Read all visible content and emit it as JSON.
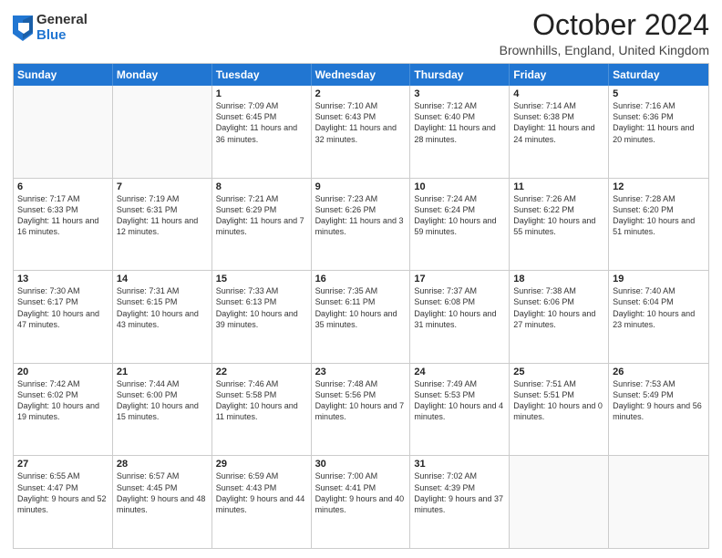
{
  "logo": {
    "general": "General",
    "blue": "Blue"
  },
  "header": {
    "month": "October 2024",
    "location": "Brownhills, England, United Kingdom"
  },
  "days": [
    "Sunday",
    "Monday",
    "Tuesday",
    "Wednesday",
    "Thursday",
    "Friday",
    "Saturday"
  ],
  "rows": [
    [
      {
        "day": "",
        "text": ""
      },
      {
        "day": "",
        "text": ""
      },
      {
        "day": "1",
        "text": "Sunrise: 7:09 AM\nSunset: 6:45 PM\nDaylight: 11 hours and 36 minutes."
      },
      {
        "day": "2",
        "text": "Sunrise: 7:10 AM\nSunset: 6:43 PM\nDaylight: 11 hours and 32 minutes."
      },
      {
        "day": "3",
        "text": "Sunrise: 7:12 AM\nSunset: 6:40 PM\nDaylight: 11 hours and 28 minutes."
      },
      {
        "day": "4",
        "text": "Sunrise: 7:14 AM\nSunset: 6:38 PM\nDaylight: 11 hours and 24 minutes."
      },
      {
        "day": "5",
        "text": "Sunrise: 7:16 AM\nSunset: 6:36 PM\nDaylight: 11 hours and 20 minutes."
      }
    ],
    [
      {
        "day": "6",
        "text": "Sunrise: 7:17 AM\nSunset: 6:33 PM\nDaylight: 11 hours and 16 minutes."
      },
      {
        "day": "7",
        "text": "Sunrise: 7:19 AM\nSunset: 6:31 PM\nDaylight: 11 hours and 12 minutes."
      },
      {
        "day": "8",
        "text": "Sunrise: 7:21 AM\nSunset: 6:29 PM\nDaylight: 11 hours and 7 minutes."
      },
      {
        "day": "9",
        "text": "Sunrise: 7:23 AM\nSunset: 6:26 PM\nDaylight: 11 hours and 3 minutes."
      },
      {
        "day": "10",
        "text": "Sunrise: 7:24 AM\nSunset: 6:24 PM\nDaylight: 10 hours and 59 minutes."
      },
      {
        "day": "11",
        "text": "Sunrise: 7:26 AM\nSunset: 6:22 PM\nDaylight: 10 hours and 55 minutes."
      },
      {
        "day": "12",
        "text": "Sunrise: 7:28 AM\nSunset: 6:20 PM\nDaylight: 10 hours and 51 minutes."
      }
    ],
    [
      {
        "day": "13",
        "text": "Sunrise: 7:30 AM\nSunset: 6:17 PM\nDaylight: 10 hours and 47 minutes."
      },
      {
        "day": "14",
        "text": "Sunrise: 7:31 AM\nSunset: 6:15 PM\nDaylight: 10 hours and 43 minutes."
      },
      {
        "day": "15",
        "text": "Sunrise: 7:33 AM\nSunset: 6:13 PM\nDaylight: 10 hours and 39 minutes."
      },
      {
        "day": "16",
        "text": "Sunrise: 7:35 AM\nSunset: 6:11 PM\nDaylight: 10 hours and 35 minutes."
      },
      {
        "day": "17",
        "text": "Sunrise: 7:37 AM\nSunset: 6:08 PM\nDaylight: 10 hours and 31 minutes."
      },
      {
        "day": "18",
        "text": "Sunrise: 7:38 AM\nSunset: 6:06 PM\nDaylight: 10 hours and 27 minutes."
      },
      {
        "day": "19",
        "text": "Sunrise: 7:40 AM\nSunset: 6:04 PM\nDaylight: 10 hours and 23 minutes."
      }
    ],
    [
      {
        "day": "20",
        "text": "Sunrise: 7:42 AM\nSunset: 6:02 PM\nDaylight: 10 hours and 19 minutes."
      },
      {
        "day": "21",
        "text": "Sunrise: 7:44 AM\nSunset: 6:00 PM\nDaylight: 10 hours and 15 minutes."
      },
      {
        "day": "22",
        "text": "Sunrise: 7:46 AM\nSunset: 5:58 PM\nDaylight: 10 hours and 11 minutes."
      },
      {
        "day": "23",
        "text": "Sunrise: 7:48 AM\nSunset: 5:56 PM\nDaylight: 10 hours and 7 minutes."
      },
      {
        "day": "24",
        "text": "Sunrise: 7:49 AM\nSunset: 5:53 PM\nDaylight: 10 hours and 4 minutes."
      },
      {
        "day": "25",
        "text": "Sunrise: 7:51 AM\nSunset: 5:51 PM\nDaylight: 10 hours and 0 minutes."
      },
      {
        "day": "26",
        "text": "Sunrise: 7:53 AM\nSunset: 5:49 PM\nDaylight: 9 hours and 56 minutes."
      }
    ],
    [
      {
        "day": "27",
        "text": "Sunrise: 6:55 AM\nSunset: 4:47 PM\nDaylight: 9 hours and 52 minutes."
      },
      {
        "day": "28",
        "text": "Sunrise: 6:57 AM\nSunset: 4:45 PM\nDaylight: 9 hours and 48 minutes."
      },
      {
        "day": "29",
        "text": "Sunrise: 6:59 AM\nSunset: 4:43 PM\nDaylight: 9 hours and 44 minutes."
      },
      {
        "day": "30",
        "text": "Sunrise: 7:00 AM\nSunset: 4:41 PM\nDaylight: 9 hours and 40 minutes."
      },
      {
        "day": "31",
        "text": "Sunrise: 7:02 AM\nSunset: 4:39 PM\nDaylight: 9 hours and 37 minutes."
      },
      {
        "day": "",
        "text": ""
      },
      {
        "day": "",
        "text": ""
      }
    ]
  ]
}
